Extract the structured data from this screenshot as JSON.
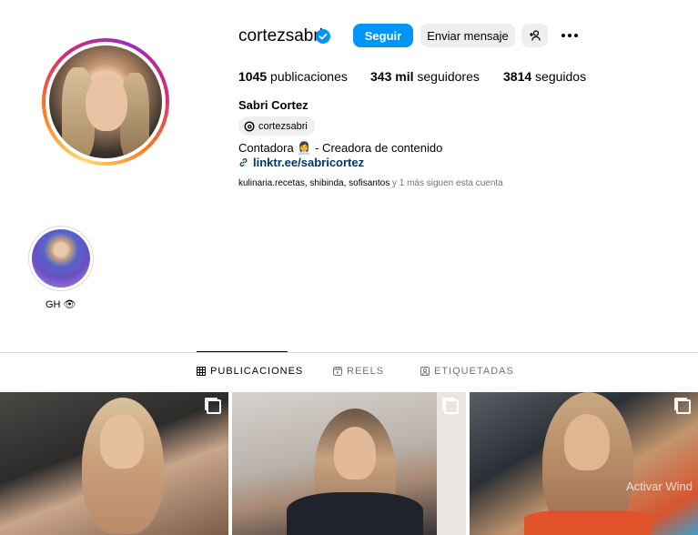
{
  "profile": {
    "username": "cortezsabri",
    "verified": true,
    "follow_label": "Seguir",
    "message_label": "Enviar mensaje",
    "add_icon": "person-plus-icon",
    "more_icon": "more-horizontal-icon",
    "avatar": "profile-photo"
  },
  "stats": {
    "posts_count": "1045",
    "posts_label": "publicaciones",
    "followers_count": "343 mil",
    "followers_label": "seguidores",
    "following_count": "3814",
    "following_label": "seguidos"
  },
  "bio": {
    "full_name": "Sabri Cortez",
    "threads_handle": "cortezsabri",
    "text": "Contadora 👩‍💼 - Creadora de contenido",
    "link": "linktr.ee/sabricortez",
    "followed_by_names": "kulinaria.recetas, shibinda, sofisantos",
    "followed_by_suffix": " y 1 más siguen esta cuenta"
  },
  "highlights": [
    {
      "label": "GH 👁"
    }
  ],
  "tabs": [
    {
      "label": "PUBLICACIONES",
      "icon": "grid-icon",
      "active": true
    },
    {
      "label": "REELS",
      "icon": "reels-icon",
      "active": false
    },
    {
      "label": "ETIQUETADAS",
      "icon": "tagged-icon",
      "active": false
    }
  ],
  "posts": [
    {
      "type": "carousel"
    },
    {
      "type": "carousel"
    },
    {
      "type": "carousel"
    }
  ],
  "overlay": {
    "watermark": "Activar Wind"
  },
  "colors": {
    "accent": "#0095f6",
    "link": "#00376b",
    "muted": "#737373",
    "border": "#dbdbdb"
  }
}
